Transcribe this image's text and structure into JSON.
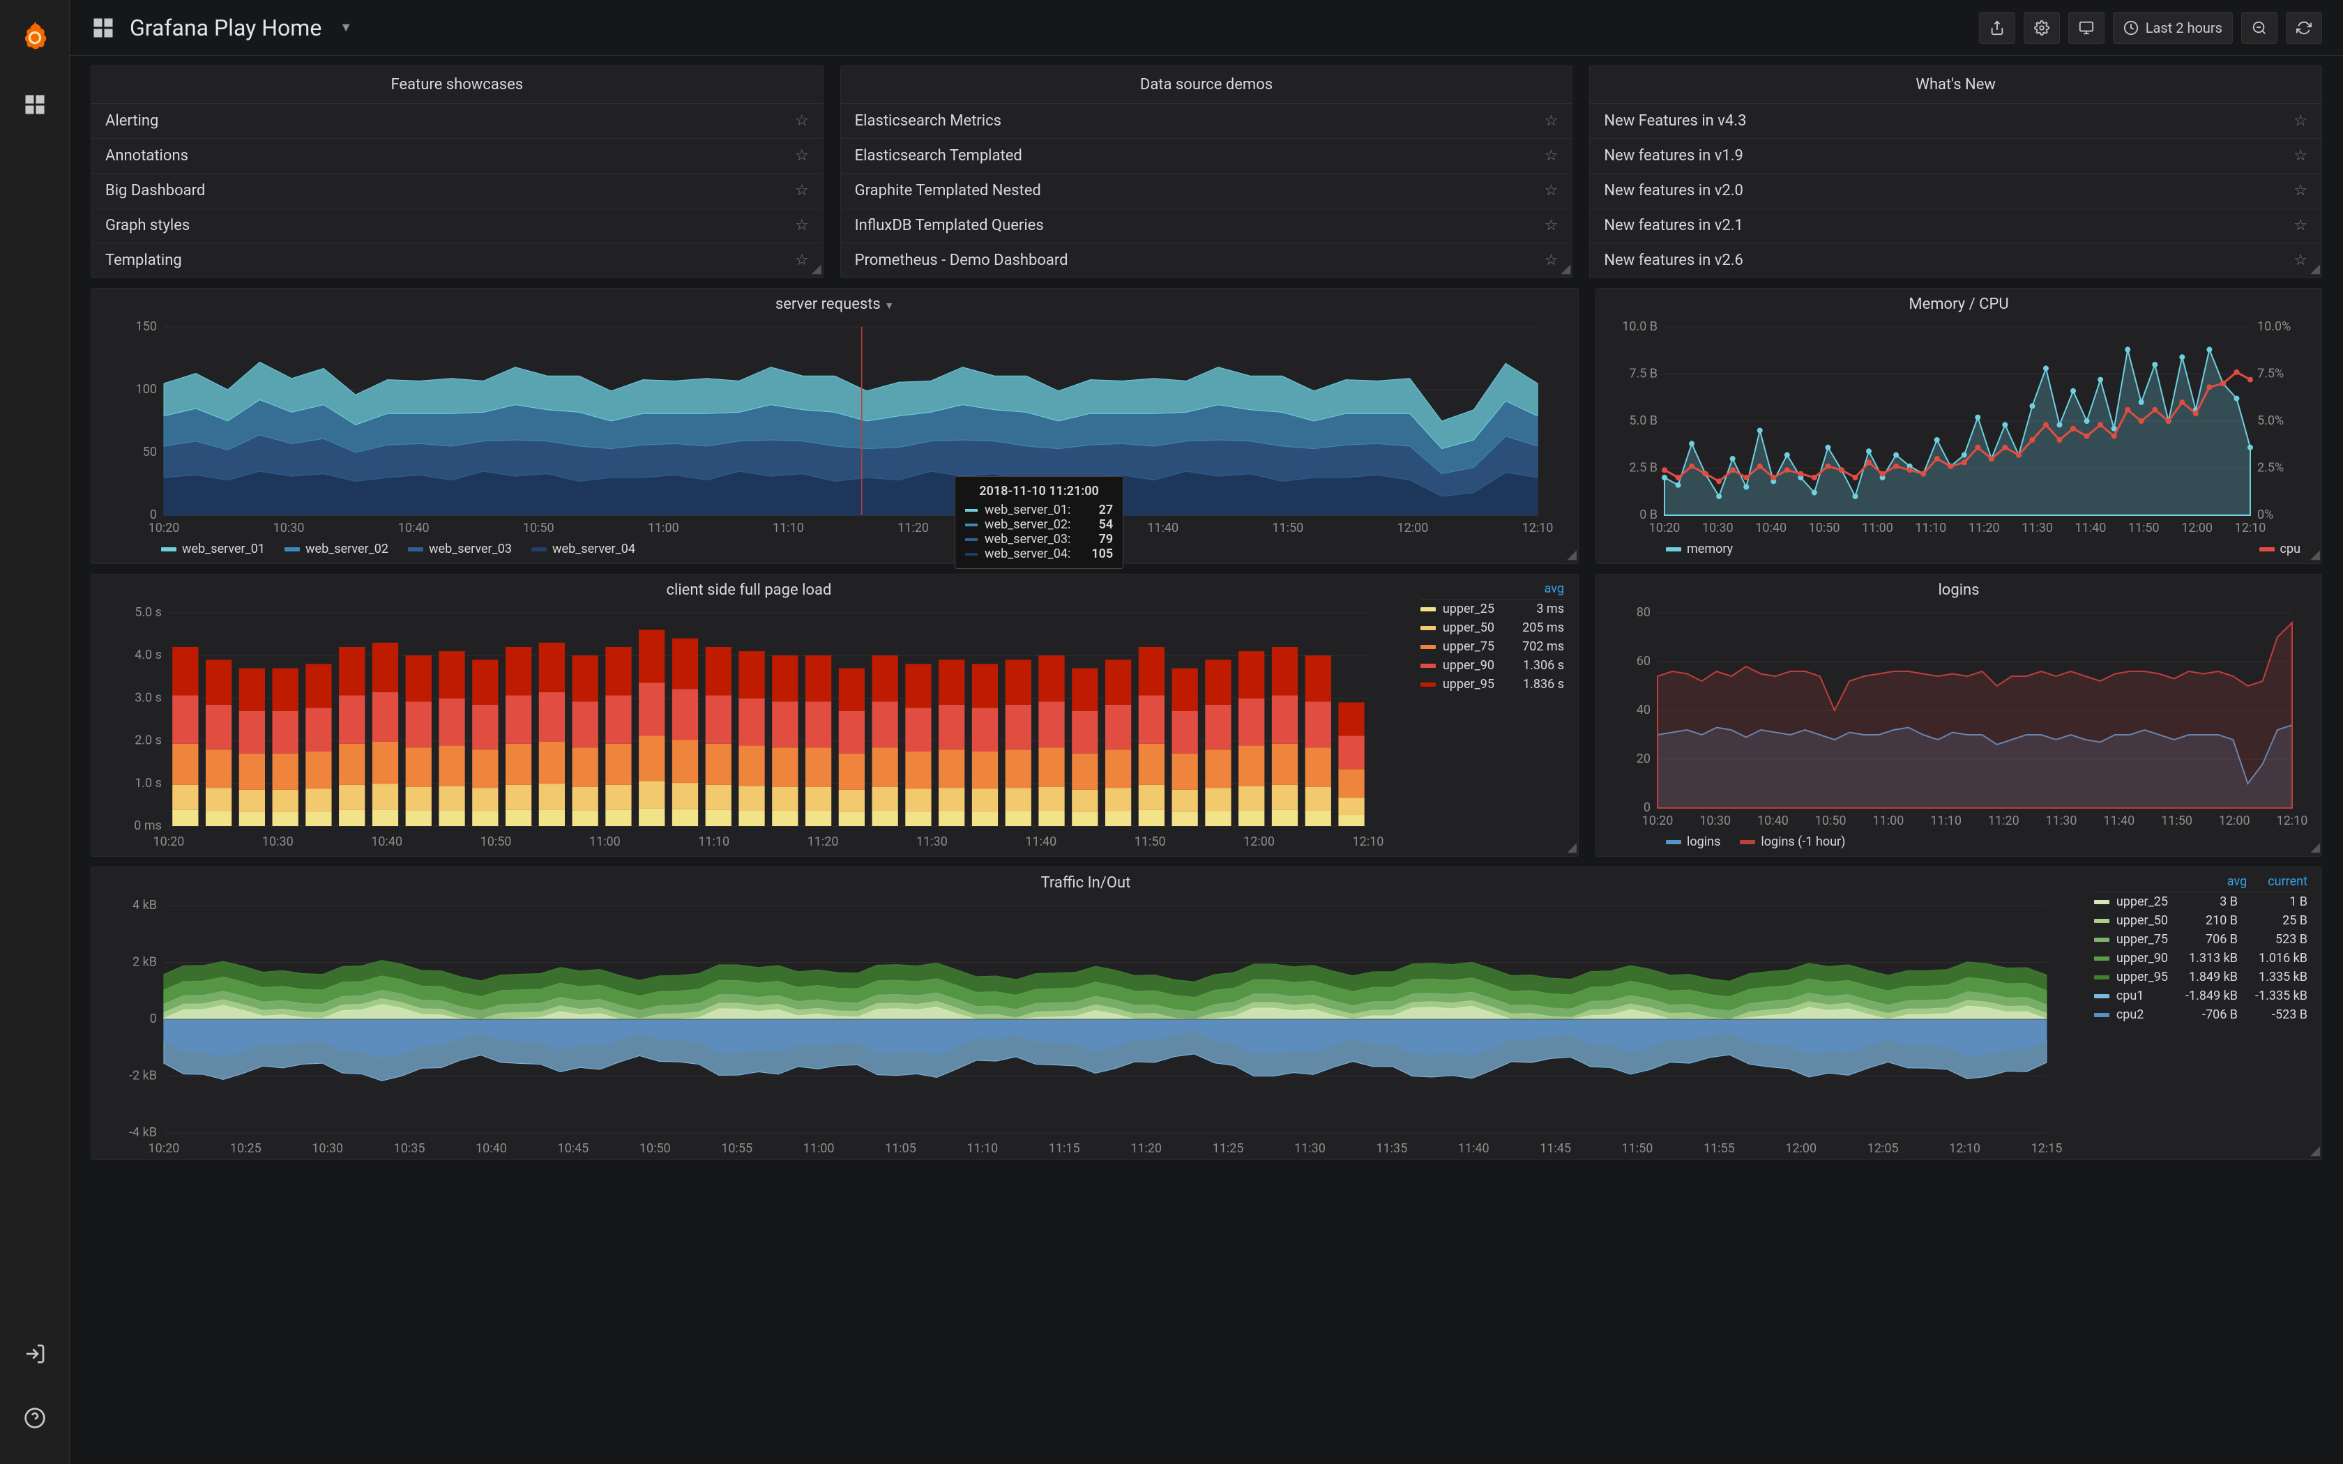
{
  "header": {
    "title": "Grafana Play Home",
    "time_range": "Last 2 hours"
  },
  "lists": {
    "feature_showcases": {
      "title": "Feature showcases",
      "items": [
        "Alerting",
        "Annotations",
        "Big Dashboard",
        "Graph styles",
        "Templating"
      ]
    },
    "data_source_demos": {
      "title": "Data source demos",
      "items": [
        "Elasticsearch Metrics",
        "Elasticsearch Templated",
        "Graphite Templated Nested",
        "InfluxDB Templated Queries",
        "Prometheus - Demo Dashboard"
      ]
    },
    "whats_new": {
      "title": "What's New",
      "items": [
        "New Features in v4.3",
        "New features in v1.9",
        "New features in v2.0",
        "New features in v2.1",
        "New features in v2.6"
      ]
    }
  },
  "tooltip": {
    "time": "2018-11-10 11:21:00",
    "rows": [
      {
        "label": "web_server_01:",
        "value": "27",
        "color": "#6ed0e0"
      },
      {
        "label": "web_server_02:",
        "value": "54",
        "color": "#3f88b8"
      },
      {
        "label": "web_server_03:",
        "value": "79",
        "color": "#2f5f94"
      },
      {
        "label": "web_server_04:",
        "value": "105",
        "color": "#1f3d6e"
      }
    ]
  },
  "panels": {
    "server_requests": {
      "title": "server requests"
    },
    "memory_cpu": {
      "title": "Memory / CPU"
    },
    "page_load": {
      "title": "client side full page load"
    },
    "logins": {
      "title": "logins"
    },
    "traffic": {
      "title": "Traffic In/Out"
    }
  },
  "legends": {
    "server_requests": [
      {
        "label": "web_server_01",
        "color": "#6ed0e0"
      },
      {
        "label": "web_server_02",
        "color": "#3f88b8"
      },
      {
        "label": "web_server_03",
        "color": "#2f5f94"
      },
      {
        "label": "web_server_04",
        "color": "#1f3d6e"
      }
    ],
    "memory_cpu": [
      {
        "label": "memory",
        "color": "#6ed0e0"
      },
      {
        "label": "cpu",
        "color": "#e24d42"
      }
    ],
    "logins": [
      {
        "label": "logins",
        "color": "#5794c9"
      },
      {
        "label": "logins (-1 hour)",
        "color": "#bf3f3a"
      }
    ],
    "page_load": {
      "header": "avg",
      "rows": [
        {
          "label": "upper_25",
          "color": "#f2e28a",
          "avg": "3 ms"
        },
        {
          "label": "upper_50",
          "color": "#f2c96d",
          "avg": "205 ms"
        },
        {
          "label": "upper_75",
          "color": "#ef843c",
          "avg": "702 ms"
        },
        {
          "label": "upper_90",
          "color": "#e24d42",
          "avg": "1.306 s"
        },
        {
          "label": "upper_95",
          "color": "#bf1b00",
          "avg": "1.836 s"
        }
      ]
    },
    "traffic": {
      "headers": [
        "avg",
        "current"
      ],
      "rows": [
        {
          "label": "upper_25",
          "color": "#d4e8b9",
          "avg": "3 B",
          "current": "1 B"
        },
        {
          "label": "upper_50",
          "color": "#a8d08d",
          "avg": "210 B",
          "current": "25 B"
        },
        {
          "label": "upper_75",
          "color": "#7eb26d",
          "avg": "706 B",
          "current": "523 B"
        },
        {
          "label": "upper_90",
          "color": "#5a9e4a",
          "avg": "1.313 kB",
          "current": "1.016 kB"
        },
        {
          "label": "upper_95",
          "color": "#3f7d2f",
          "avg": "1.849 kB",
          "current": "1.335 kB"
        },
        {
          "label": "cpu1",
          "color": "#7fb8e0",
          "avg": "-1.849 kB",
          "current": "-1.335 kB"
        },
        {
          "label": "cpu2",
          "color": "#5a8fc4",
          "avg": "-706 B",
          "current": "-523 B"
        }
      ]
    }
  },
  "chart_data": [
    {
      "id": "server_requests",
      "type": "area",
      "title": "server requests",
      "ylabel": "",
      "ylim": [
        0,
        150
      ],
      "x_ticks": [
        "10:20",
        "10:30",
        "10:40",
        "10:50",
        "11:00",
        "11:10",
        "11:20",
        "11:30",
        "11:40",
        "11:50",
        "12:00",
        "12:10"
      ],
      "y_ticks": [
        0,
        50,
        100,
        150
      ],
      "stacked": true,
      "series": [
        {
          "name": "web_server_01",
          "color": "#6ed0e0",
          "values": [
            26,
            28,
            25,
            30,
            27,
            29,
            24,
            27,
            26,
            28,
            25,
            30,
            27,
            29,
            24,
            27,
            26,
            28,
            25,
            30,
            27,
            29,
            24,
            27,
            25,
            30,
            27,
            29,
            24,
            27,
            26,
            28,
            25,
            30,
            27,
            29,
            24,
            27,
            26,
            28,
            22,
            24,
            30,
            26
          ]
        },
        {
          "name": "web_server_02",
          "color": "#3f88b8",
          "values": [
            24,
            26,
            23,
            28,
            25,
            27,
            22,
            25,
            24,
            26,
            23,
            28,
            25,
            27,
            22,
            25,
            24,
            26,
            23,
            28,
            25,
            27,
            22,
            25,
            23,
            28,
            25,
            27,
            22,
            25,
            24,
            26,
            23,
            28,
            25,
            27,
            22,
            25,
            24,
            26,
            20,
            22,
            28,
            24
          ]
        },
        {
          "name": "web_server_03",
          "color": "#2f5f94",
          "values": [
            25,
            27,
            24,
            29,
            26,
            28,
            23,
            26,
            25,
            27,
            24,
            29,
            26,
            28,
            23,
            26,
            25,
            27,
            24,
            29,
            26,
            28,
            23,
            26,
            24,
            29,
            26,
            28,
            23,
            26,
            25,
            27,
            24,
            29,
            26,
            28,
            23,
            26,
            25,
            27,
            18,
            20,
            29,
            25
          ]
        },
        {
          "name": "web_server_04",
          "color": "#1f3d6e",
          "values": [
            30,
            32,
            28,
            35,
            31,
            33,
            27,
            30,
            32,
            28,
            35,
            31,
            33,
            27,
            30,
            30,
            32,
            28,
            35,
            31,
            33,
            27,
            30,
            28,
            35,
            31,
            33,
            27,
            30,
            30,
            32,
            28,
            35,
            31,
            33,
            27,
            30,
            30,
            32,
            28,
            15,
            18,
            34,
            30
          ]
        }
      ]
    },
    {
      "id": "memory_cpu",
      "type": "line",
      "title": "Memory / CPU",
      "y_left_ticks": [
        "0 B",
        "2.5 B",
        "5.0 B",
        "7.5 B",
        "10.0 B"
      ],
      "y_right_ticks": [
        "0%",
        "2.5%",
        "5.0%",
        "7.5%",
        "10.0%"
      ],
      "x_ticks": [
        "10:20",
        "10:30",
        "10:40",
        "10:50",
        "11:00",
        "11:10",
        "11:20",
        "11:30",
        "11:40",
        "11:50",
        "12:00",
        "12:10"
      ],
      "ylim_left": [
        0,
        10
      ],
      "ylim_right": [
        0,
        10
      ],
      "series": [
        {
          "name": "memory",
          "axis": "left",
          "color": "#6ed0e0",
          "values": [
            2.0,
            1.6,
            3.8,
            2.2,
            1.0,
            3.0,
            1.5,
            4.5,
            1.8,
            3.2,
            2.0,
            1.2,
            3.6,
            2.4,
            1.0,
            3.4,
            2.0,
            3.2,
            2.6,
            2.2,
            4.0,
            2.6,
            3.2,
            5.2,
            3.0,
            4.8,
            3.2,
            5.8,
            7.8,
            4.8,
            6.6,
            5.0,
            7.2,
            4.6,
            8.8,
            6.0,
            8.0,
            5.0,
            8.4,
            5.6,
            8.8,
            7.0,
            6.2,
            3.6
          ]
        },
        {
          "name": "cpu",
          "axis": "right",
          "color": "#e24d42",
          "values": [
            2.4,
            2.0,
            2.6,
            2.2,
            1.8,
            2.4,
            2.0,
            2.6,
            2.0,
            2.4,
            2.2,
            2.0,
            2.6,
            2.4,
            2.0,
            2.8,
            2.2,
            2.6,
            2.4,
            2.2,
            3.0,
            2.6,
            2.8,
            3.6,
            3.0,
            3.6,
            3.2,
            4.0,
            4.8,
            4.0,
            4.6,
            4.2,
            4.8,
            4.2,
            5.6,
            5.0,
            5.6,
            5.0,
            6.0,
            5.4,
            6.8,
            7.0,
            7.6,
            7.2
          ]
        }
      ]
    },
    {
      "id": "page_load",
      "type": "bar",
      "title": "client side full page load",
      "y_ticks": [
        "0 ms",
        "1.0 s",
        "2.0 s",
        "3.0 s",
        "4.0 s",
        "5.0 s"
      ],
      "x_ticks": [
        "10:20",
        "10:30",
        "10:40",
        "10:50",
        "11:00",
        "11:10",
        "11:20",
        "11:30",
        "11:40",
        "11:50",
        "12:00",
        "12:10"
      ],
      "ylim": [
        0,
        5000
      ],
      "stacked": true,
      "categories_count": 36,
      "series": [
        {
          "name": "upper_25",
          "color": "#f2e28a",
          "value_per_bar_approx": 400
        },
        {
          "name": "upper_50",
          "color": "#f2c96d",
          "value_per_bar_approx": 600
        },
        {
          "name": "upper_75",
          "color": "#ef843c",
          "value_per_bar_approx": 1000
        },
        {
          "name": "upper_90",
          "color": "#e24d42",
          "value_per_bar_approx": 1200
        },
        {
          "name": "upper_95",
          "color": "#bf1b00",
          "value_per_bar_approx": 1200
        }
      ],
      "bar_totals": [
        4200,
        3900,
        3700,
        3700,
        3800,
        4200,
        4300,
        4000,
        4100,
        3900,
        4200,
        4300,
        4000,
        4200,
        4600,
        4400,
        4200,
        4100,
        4000,
        4000,
        3700,
        4000,
        3800,
        3900,
        3800,
        3900,
        4000,
        3700,
        3900,
        4200,
        3700,
        3900,
        4100,
        4200,
        4000,
        2900
      ]
    },
    {
      "id": "logins",
      "type": "line",
      "title": "logins",
      "y_ticks": [
        0,
        20,
        40,
        60,
        80
      ],
      "x_ticks": [
        "10:20",
        "10:30",
        "10:40",
        "10:50",
        "11:00",
        "11:10",
        "11:20",
        "11:30",
        "11:40",
        "11:50",
        "12:00",
        "12:10"
      ],
      "ylim": [
        0,
        80
      ],
      "series": [
        {
          "name": "logins",
          "color": "#5794c9",
          "values": [
            30,
            31,
            32,
            30,
            33,
            32,
            29,
            32,
            31,
            30,
            32,
            30,
            28,
            31,
            30,
            30,
            32,
            33,
            30,
            28,
            31,
            30,
            30,
            26,
            28,
            30,
            30,
            28,
            30,
            28,
            27,
            30,
            30,
            32,
            30,
            28,
            30,
            30,
            30,
            28,
            10,
            18,
            32,
            34
          ]
        },
        {
          "name": "logins (-1 hour)",
          "color": "#bf3f3a",
          "values": [
            54,
            56,
            55,
            52,
            56,
            54,
            58,
            55,
            54,
            56,
            56,
            54,
            40,
            52,
            54,
            55,
            56,
            56,
            55,
            54,
            55,
            54,
            56,
            50,
            54,
            54,
            56,
            54,
            56,
            54,
            52,
            55,
            56,
            56,
            55,
            53,
            56,
            55,
            56,
            54,
            50,
            52,
            70,
            76
          ]
        }
      ]
    },
    {
      "id": "traffic",
      "type": "area",
      "title": "Traffic In/Out",
      "y_ticks": [
        "-4 kB",
        "-2 kB",
        "0",
        "2 kB",
        "4 kB"
      ],
      "x_ticks": [
        "10:20",
        "10:25",
        "10:30",
        "10:35",
        "10:40",
        "10:45",
        "10:50",
        "10:55",
        "11:00",
        "11:05",
        "11:10",
        "11:15",
        "11:20",
        "11:25",
        "11:30",
        "11:35",
        "11:40",
        "11:45",
        "11:50",
        "11:55",
        "12:00",
        "12:05",
        "12:10",
        "12:15"
      ],
      "ylim": [
        -4000,
        4000
      ],
      "positive_series": [
        {
          "name": "upper_25",
          "color": "#d4e8b9"
        },
        {
          "name": "upper_50",
          "color": "#a8d08d"
        },
        {
          "name": "upper_75",
          "color": "#7eb26d"
        },
        {
          "name": "upper_90",
          "color": "#5a9e4a"
        },
        {
          "name": "upper_95",
          "color": "#3f7d2f"
        }
      ],
      "negative_series": [
        {
          "name": "cpu1",
          "color": "#7fb8e0"
        },
        {
          "name": "cpu2",
          "color": "#5a8fc4"
        }
      ]
    }
  ]
}
